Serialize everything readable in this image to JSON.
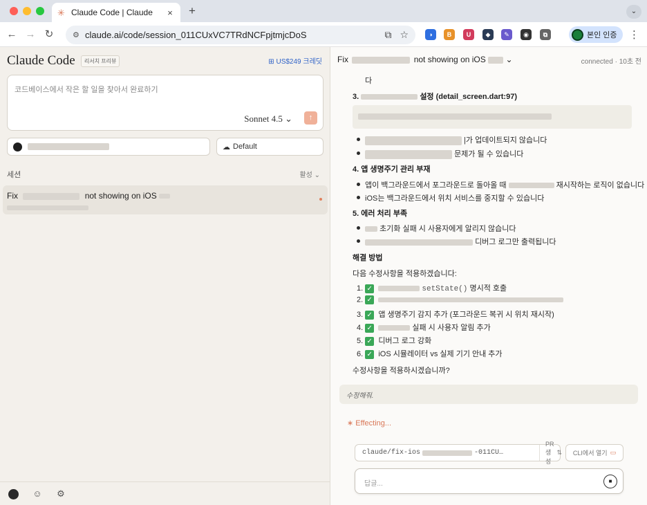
{
  "browser": {
    "tab_title": "Claude Code | Claude",
    "tab_close": "×",
    "new_tab": "+",
    "tab_menu": "⌄",
    "url": "claude.ai/code/session_011CUxVC7TRdNCFpjtmjcDoS",
    "profile_label": "본인 인증",
    "nav": {
      "back": "←",
      "forward": "→",
      "reload": "↻",
      "site_settings": "⚙",
      "cast": "⧉",
      "bookmark": "☆",
      "kebab": "⋮"
    },
    "extensions": [
      {
        "name": "ext-blue-icon",
        "glyph": "◑",
        "color": "#2f6fe0"
      },
      {
        "name": "ext-orange-icon",
        "glyph": "B",
        "color": "#e8922a"
      },
      {
        "name": "ext-red-shield-icon",
        "glyph": "U",
        "color": "#d23b5c"
      },
      {
        "name": "ext-dark-icon",
        "glyph": "◆",
        "color": "#2a3b55"
      },
      {
        "name": "ext-purple-icon",
        "glyph": "✎",
        "color": "#6a5acd"
      },
      {
        "name": "ext-tampermonkey-icon",
        "glyph": "◉",
        "color": "#333333"
      },
      {
        "name": "ext-puzzle-icon",
        "glyph": "⧉",
        "color": "#666666"
      }
    ]
  },
  "left": {
    "brand": "Claude Code",
    "preview_badge": "리서치 프리뷰",
    "credit": "US$249 크레딧",
    "credit_icon": "⊞",
    "prompt_placeholder": "코드베이스에서 작은 할 일을 찾아서 완료하기",
    "model": "Sonnet 4.5 ⌄",
    "send_icon": "↑",
    "env_label": "Default",
    "env_icon": "☁",
    "sessions_label": "세션",
    "filter_label": "활성 ⌄",
    "session": {
      "title_start": "Fix",
      "title_end": "not showing on iOS"
    },
    "footer_icons": [
      "☺",
      "⚙"
    ]
  },
  "right": {
    "header_title_start": "Fix",
    "header_title_end": "not showing on iOS",
    "header_chevron": "⌄",
    "status": "connected · 10초 전",
    "top_fragment": "다",
    "h3": "설정 (detail_screen.dart:97)",
    "h3_prefix": "3.",
    "b1": "|가 업데이트되지 않습니다",
    "b2": "문제가 될 수 있습니다",
    "h4": "4. 앱 생명주기 관리 부재",
    "b3_start": "앱이 백그라운드에서 포그라운드로 돌아올 때",
    "b3_end": "재시작하는 로직이 없습니다",
    "b4": "iOS는 백그라운드에서 위치 서비스를 중지할 수 있습니다",
    "h5": "5. 에러 처리 부족",
    "b5": "초기화 실패 시 사용자에게 알리지 않습니다",
    "b6": "디버그 로그만 출력됩니다",
    "solution_heading": "해결 방법",
    "solution_intro": "다음 수정사항을 적용하겠습니다:",
    "check_glyph": "✓",
    "fixes": [
      {
        "num": "1.",
        "text": "명시적 호출",
        "code": "setState()"
      },
      {
        "num": "2.",
        "text": ""
      },
      {
        "num": "3.",
        "text": "앱 생명주기 감지 추가 (포그라운드 복귀 시 위치 재시작)"
      },
      {
        "num": "4.",
        "text": "실패 시 사용자 알림 추가"
      },
      {
        "num": "5.",
        "text": "디버그 로그 강화"
      },
      {
        "num": "6.",
        "text": "iOS 시뮬레이터 vs 실제 기기 안내 추가"
      }
    ],
    "closing": "수정사항을 적용하시겠습니까?",
    "user_message": "수정해줘.",
    "effecting": "∗ Effecting...",
    "branch_start": "claude/fix-ios",
    "branch_end": "-011CU…",
    "pr_label": "PR 생성",
    "pr_icon": "⇅",
    "cli_label": "CLI에서 열기",
    "cli_icon": "▭",
    "reply_placeholder": "답글...",
    "reply_stop_icon": "■"
  }
}
